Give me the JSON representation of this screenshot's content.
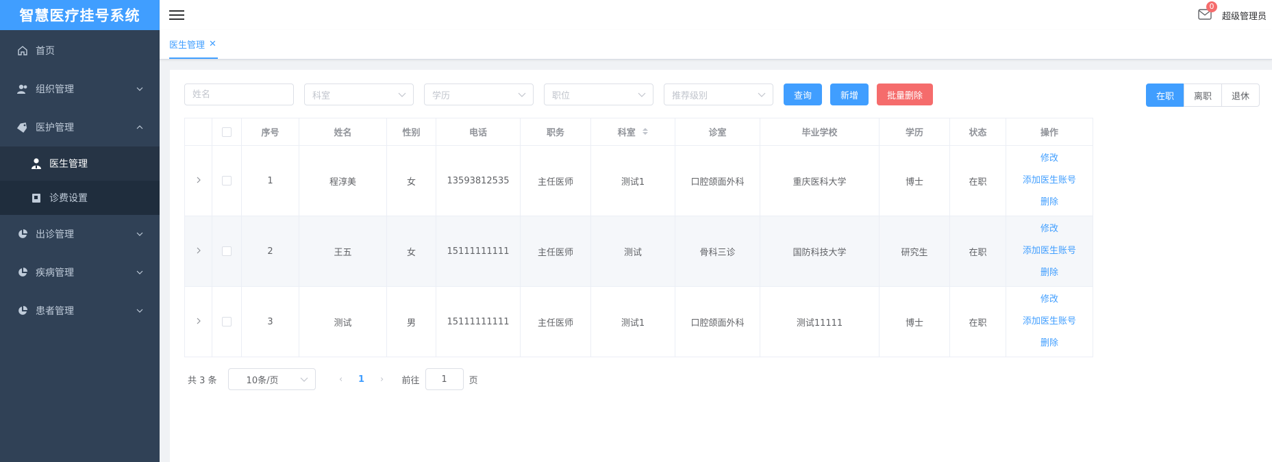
{
  "app": {
    "title": "智慧医疗挂号系统"
  },
  "sidebar": {
    "items": [
      {
        "label": "首页",
        "icon": "home-icon"
      },
      {
        "label": "组织管理",
        "icon": "users-icon"
      },
      {
        "label": "医护管理",
        "icon": "tag-icon"
      },
      {
        "label": "出诊管理",
        "icon": "pie-icon"
      },
      {
        "label": "疾病管理",
        "icon": "pie-icon"
      },
      {
        "label": "患者管理",
        "icon": "pie-icon"
      }
    ],
    "submenu": [
      {
        "label": "医生管理",
        "icon": "doctor-icon"
      },
      {
        "label": "诊费设置",
        "icon": "fee-icon"
      }
    ]
  },
  "header": {
    "badge": "0",
    "user": "超级管理员"
  },
  "tabs": [
    {
      "label": "医生管理"
    }
  ],
  "filters": {
    "name_placeholder": "姓名",
    "dept_placeholder": "科室",
    "edu_placeholder": "学历",
    "position_placeholder": "职位",
    "level_placeholder": "推荐级别",
    "query_label": "查询",
    "add_label": "新增",
    "batch_delete_label": "批量删除"
  },
  "status_tabs": [
    "在职",
    "离职",
    "退休"
  ],
  "table": {
    "headers": [
      "序号",
      "姓名",
      "性别",
      "电话",
      "职务",
      "科室",
      "诊室",
      "毕业学校",
      "学历",
      "状态",
      "操作"
    ],
    "rows": [
      {
        "no": "1",
        "name": "程淳美",
        "gender": "女",
        "phone": "13593812535",
        "duty": "主任医师",
        "dept": "测试1",
        "room": "口腔颌面外科",
        "school": "重庆医科大学",
        "edu": "博士",
        "status": "在职"
      },
      {
        "no": "2",
        "name": "王五",
        "gender": "女",
        "phone": "15111111111",
        "duty": "主任医师",
        "dept": "测试",
        "room": "骨科三诊",
        "school": "国防科技大学",
        "edu": "研究生",
        "status": "在职"
      },
      {
        "no": "3",
        "name": "测试",
        "gender": "男",
        "phone": "15111111111",
        "duty": "主任医师",
        "dept": "测试1",
        "room": "口腔颌面外科",
        "school": "测试11111",
        "edu": "博士",
        "status": "在职"
      }
    ],
    "ops": {
      "edit": "修改",
      "add_account": "添加医生账号",
      "delete": "删除"
    }
  },
  "pagination": {
    "total": "共 3 条",
    "page_size": "10条/页",
    "current": "1",
    "goto_prefix": "前往",
    "goto_value": "1",
    "goto_suffix": "页"
  },
  "colors": {
    "sidebar": "#304156",
    "accent": "#409eff",
    "danger": "#f56c6c"
  }
}
